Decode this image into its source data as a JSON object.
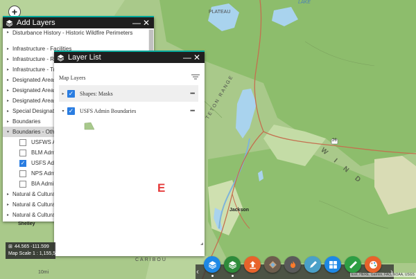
{
  "map": {
    "labels": {
      "plateau": "PLATEAU",
      "lake": "LAKE",
      "windriver": "W I N D",
      "range": "TETON RANGE",
      "jackson": "Jackson",
      "shelley": "Shelley",
      "caribou": "CARIBOU",
      "route": "26",
      "ten_mi": "10mi"
    },
    "colors": {
      "terrain": "#a9c98a",
      "forest": "#8fbf6f",
      "water": "#a9d3ee",
      "road": "#c46f4f",
      "grass": "#d9e8c0"
    }
  },
  "zoom": {
    "label": "+"
  },
  "add_layers": {
    "title": "Add Layers",
    "items": [
      {
        "label": "Disturbance History - Historic Wildfire Perimeters",
        "kind": "group"
      },
      {
        "label": "Infrastructure - Facilities",
        "kind": "group"
      },
      {
        "label": "Infrastructure - Roads",
        "kind": "group"
      },
      {
        "label": "Infrastructure - Trails",
        "kind": "group"
      },
      {
        "label": "Designated Areas - Wilderness",
        "kind": "group"
      },
      {
        "label": "Designated Areas - Research Natural Areas",
        "kind": "group"
      },
      {
        "label": "Designated Areas - Inventoried Roadless",
        "kind": "group"
      },
      {
        "label": "Special Designations",
        "kind": "group"
      },
      {
        "label": "Boundaries",
        "kind": "group"
      },
      {
        "label": "Boundaries - Other Agency",
        "kind": "group-open"
      },
      {
        "label": "USFWS Admin Boundaries",
        "kind": "child",
        "checked": false
      },
      {
        "label": "BLM Admin Boundaries",
        "kind": "child",
        "checked": false
      },
      {
        "label": "USFS Admin Boundaries",
        "kind": "child",
        "checked": true
      },
      {
        "label": "NPS Admin Boundaries",
        "kind": "child",
        "checked": false
      },
      {
        "label": "BIA Admin Boundaries",
        "kind": "child",
        "checked": false
      },
      {
        "label": "Natural & Cultural Resources",
        "kind": "group"
      },
      {
        "label": "Natural & Cultural Resources - Wildlife",
        "kind": "group"
      },
      {
        "label": "Natural & Cultural Resources - Heritage",
        "kind": "group"
      }
    ]
  },
  "layer_list": {
    "title": "Layer List",
    "section_label": "Map Layers",
    "layers": [
      {
        "name": "Shapes: Masks",
        "checked": true,
        "expanded": false
      },
      {
        "name": "USFS Admin Boundaries",
        "checked": true,
        "expanded": true
      }
    ],
    "legend_color": "#a8c98c"
  },
  "marker_label": "E",
  "coordinates": {
    "readout": "44.565 -111.599",
    "scale": "Map Scale 1 : 1,155,581"
  },
  "toolbar": {
    "buttons": [
      {
        "name": "layer-list",
        "color": "#1e88e5",
        "icon": "layers-icon"
      },
      {
        "name": "add-layers",
        "color": "#2e8b3a",
        "icon": "add-layers-icon"
      },
      {
        "name": "upload",
        "color": "#e8632b",
        "icon": "upload-icon"
      },
      {
        "name": "basemap",
        "color": "#6d5d4d",
        "icon": "basemap-icon"
      },
      {
        "name": "fire",
        "color": "#5a5a5a",
        "icon": "fire-icon"
      },
      {
        "name": "draw",
        "color": "#4aa0c8",
        "icon": "draw-icon"
      },
      {
        "name": "apps",
        "color": "#1e88e5",
        "icon": "grid-icon"
      },
      {
        "name": "measure",
        "color": "#2e9e44",
        "icon": "ruler-icon"
      },
      {
        "name": "theme",
        "color": "#e8632b",
        "icon": "palette-icon"
      }
    ]
  },
  "attribution": "Esri, HERE, Garmin, FAO, NOAA, USGS"
}
